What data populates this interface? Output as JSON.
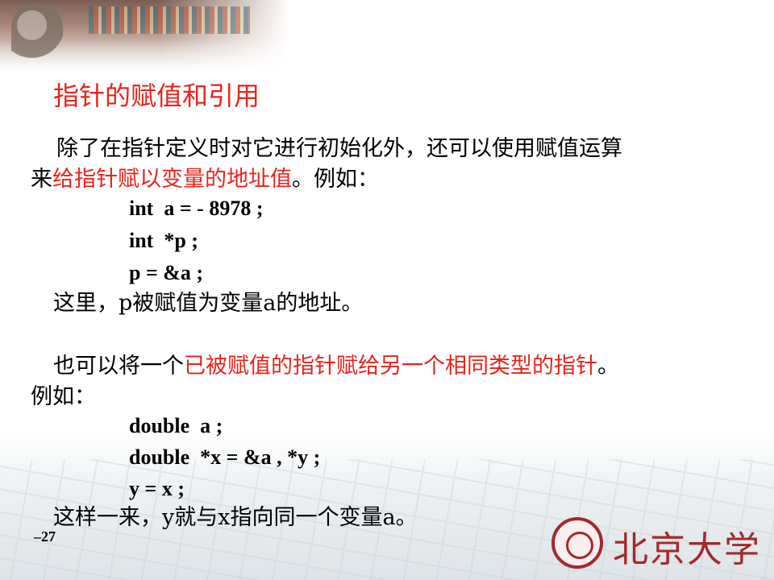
{
  "title": "指针的赋值和引用",
  "para1": {
    "line1": "除了在指针定义时对它进行初始化外，还可以使用赋值运算",
    "line2_pre": "来",
    "line2_red": "给指针赋以变量的地址值",
    "line2_post": "。例如："
  },
  "code1": [
    "int  a = - 8978 ;",
    "int  *p ;",
    "p = &a ;"
  ],
  "para1_note": "这里，p被赋值为变量a的地址。",
  "para2": {
    "line1_pre": "也可以将一个",
    "line1_red": "已被赋值的指针赋给另一个相同类型的指针",
    "line1_post": "。",
    "line2": "例如："
  },
  "code2": [
    "double  a ;",
    "double  *x = &a , *y ;",
    "y = x ;"
  ],
  "para2_note": "这样一来，y就与x指向同一个变量a。",
  "page_number": "–27",
  "logo": {
    "name": "北京大学",
    "seal_text": "PEKING UNIVERSITY 1898",
    "color": "#a3282c"
  },
  "accent_color": "#e8231b"
}
